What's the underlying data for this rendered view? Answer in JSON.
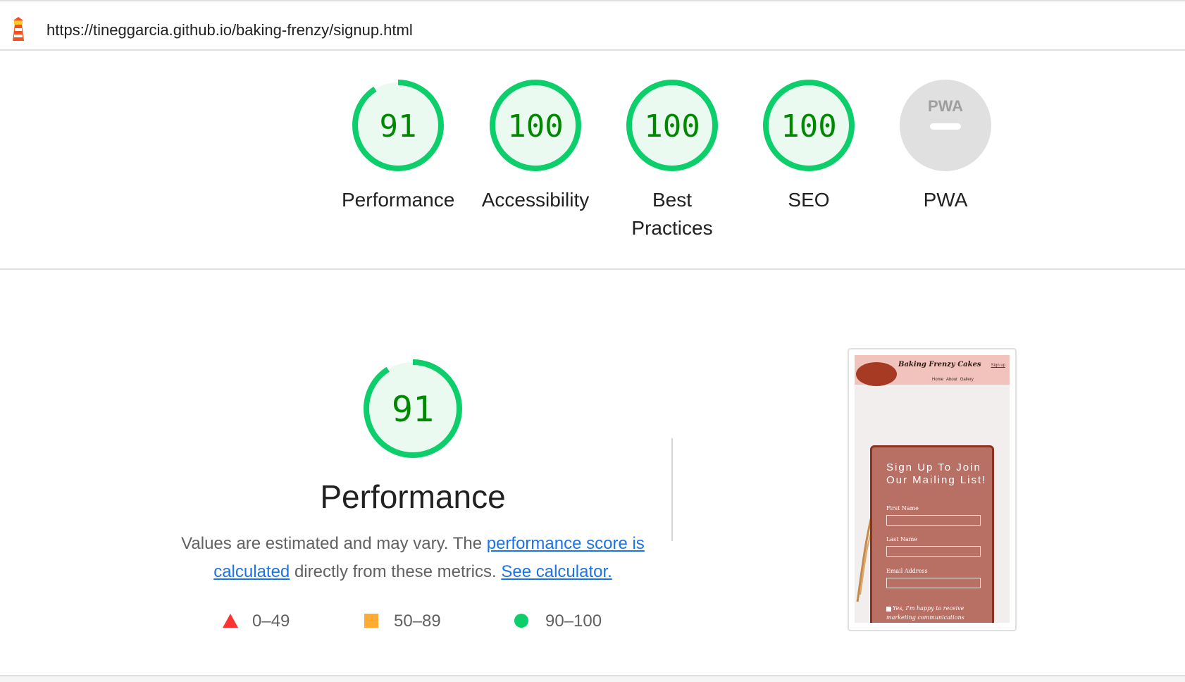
{
  "header": {
    "url": "https://tineggarcia.github.io/baking-frenzy/signup.html",
    "logo_icon": "lighthouse-icon"
  },
  "gauges": [
    {
      "score": "91",
      "value": 91,
      "label": "Performance"
    },
    {
      "score": "100",
      "value": 100,
      "label": "Accessibility"
    },
    {
      "score": "100",
      "value": 100,
      "label": "Best Practices"
    },
    {
      "score": "100",
      "value": 100,
      "label": "SEO"
    },
    {
      "badge": "PWA",
      "label": "PWA"
    }
  ],
  "performance": {
    "score": "91",
    "value": 91,
    "title": "Performance",
    "desc_prefix": "Values are estimated and may vary. The ",
    "desc_link1": "performance score is calculated",
    "desc_middle": " directly from these metrics. ",
    "desc_link2": "See calculator.",
    "legend": [
      {
        "range": "0–49",
        "icon": "triangle-icon",
        "color": "#ff3333"
      },
      {
        "range": "50–89",
        "icon": "square-icon",
        "color": "#ffaa33"
      },
      {
        "range": "90–100",
        "icon": "circle-icon",
        "color": "#0cce6b"
      }
    ]
  },
  "screenshot": {
    "brand": "Baking Frenzy Cakes",
    "signup": "Sign up",
    "nav": [
      "Home",
      "About",
      "Gallery"
    ],
    "card_title": "Sign Up To Join Our Mailing List!",
    "fields": [
      "First Name",
      "Last Name",
      "Email Address"
    ],
    "checkbox": "Yes, I'm happy to receive marketing communications from you and agree to your privacy policy."
  },
  "colors": {
    "pass_green": "#0cce6b",
    "score_text": "#008800",
    "gauge_fill": "#eafaf1",
    "link": "#1a73e8",
    "pwa_grey": "#e0e0e0"
  }
}
